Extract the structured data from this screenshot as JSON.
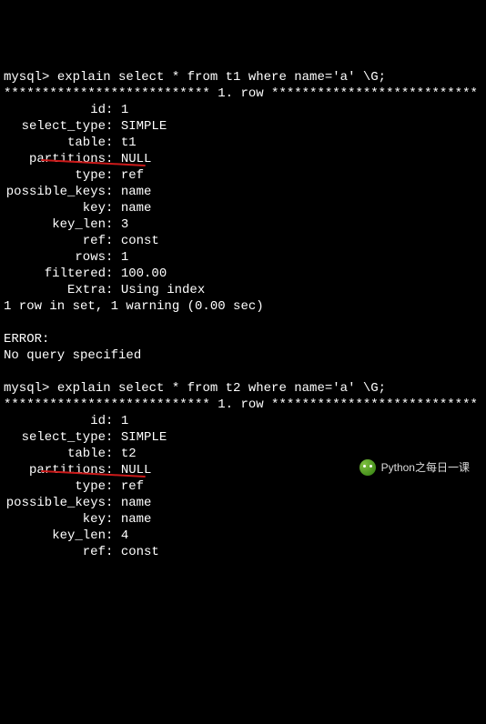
{
  "block1": {
    "prompt": "mysql> ",
    "query": "explain select * from t1 where name='a' \\G;",
    "row_header": "*************************** 1. row ***************************",
    "fields": [
      {
        "k": "id",
        "v": "1"
      },
      {
        "k": "select_type",
        "v": "SIMPLE"
      },
      {
        "k": "table",
        "v": "t1"
      },
      {
        "k": "partitions",
        "v": "NULL"
      },
      {
        "k": "type",
        "v": "ref"
      },
      {
        "k": "possible_keys",
        "v": "name"
      },
      {
        "k": "key",
        "v": "name"
      },
      {
        "k": "key_len",
        "v": "3"
      },
      {
        "k": "ref",
        "v": "const"
      },
      {
        "k": "rows",
        "v": "1"
      },
      {
        "k": "filtered",
        "v": "100.00"
      },
      {
        "k": "Extra",
        "v": "Using index"
      }
    ],
    "footer": "1 row in set, 1 warning (0.00 sec)"
  },
  "error": {
    "label": "ERROR:",
    "msg": "No query specified"
  },
  "block2": {
    "prompt": "mysql> ",
    "query": "explain select * from t2 where name='a' \\G;",
    "row_header": "*************************** 1. row ***************************",
    "fields": [
      {
        "k": "id",
        "v": "1"
      },
      {
        "k": "select_type",
        "v": "SIMPLE"
      },
      {
        "k": "table",
        "v": "t2"
      },
      {
        "k": "partitions",
        "v": "NULL"
      },
      {
        "k": "type",
        "v": "ref"
      },
      {
        "k": "possible_keys",
        "v": "name"
      },
      {
        "k": "key",
        "v": "name"
      },
      {
        "k": "key_len",
        "v": "4"
      },
      {
        "k": "ref",
        "v": "const"
      }
    ]
  },
  "watermark": "Python之每日一课"
}
